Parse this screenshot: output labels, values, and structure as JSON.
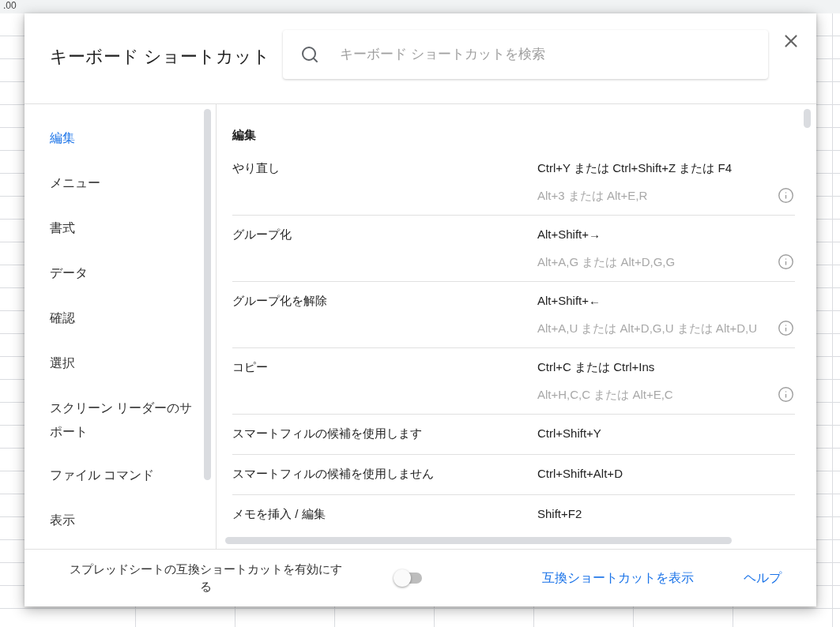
{
  "background": {
    "toolbar_text": ".00"
  },
  "dialog": {
    "title": "キーボード ショートカット",
    "search": {
      "placeholder": "キーボード ショートカットを検索"
    },
    "categories": [
      {
        "label": "編集",
        "selected": true
      },
      {
        "label": "メニュー",
        "selected": false
      },
      {
        "label": "書式",
        "selected": false
      },
      {
        "label": "データ",
        "selected": false
      },
      {
        "label": "確認",
        "selected": false
      },
      {
        "label": "選択",
        "selected": false
      },
      {
        "label": "スクリーン リーダーのサポート",
        "selected": false
      },
      {
        "label": "ファイル コマンド",
        "selected": false
      },
      {
        "label": "表示",
        "selected": false
      }
    ],
    "section_title": "編集",
    "shortcuts": [
      {
        "action": "やり直し",
        "keys": "Ctrl+Y または Ctrl+Shift+Z または F4",
        "alternate": "Alt+3 または Alt+E,R"
      },
      {
        "action": "グループ化",
        "keys": "Alt+Shift+→",
        "alternate": "Alt+A,G または Alt+D,G,G"
      },
      {
        "action": "グループ化を解除",
        "keys": "Alt+Shift+←",
        "alternate": "Alt+A,U または Alt+D,G,U または Alt+D,U"
      },
      {
        "action": "コピー",
        "keys": "Ctrl+C または Ctrl+Ins",
        "alternate": "Alt+H,C,C または Alt+E,C"
      },
      {
        "action": "スマートフィルの候補を使用します",
        "keys": "Ctrl+Shift+Y"
      },
      {
        "action": "スマートフィルの候補を使用しません",
        "keys": "Ctrl+Shift+Alt+D"
      },
      {
        "action": "メモを挿入 / 編集",
        "keys": "Shift+F2"
      }
    ],
    "footer": {
      "toggle": {
        "label": "スプレッドシートの互換ショートカットを有効にする",
        "on": false
      },
      "links": [
        "互換ショートカットを表示",
        "ヘルプ"
      ]
    }
  }
}
